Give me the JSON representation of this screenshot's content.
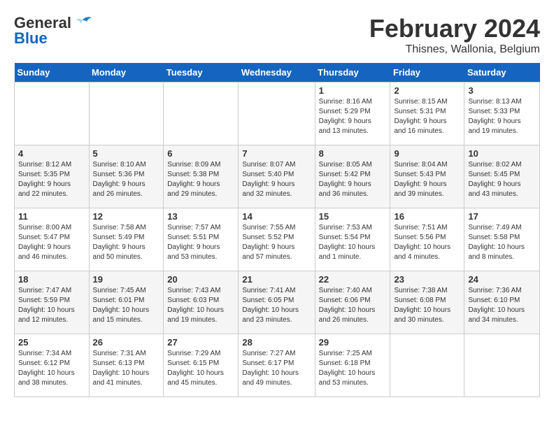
{
  "header": {
    "logo_general": "General",
    "logo_blue": "Blue",
    "month_year": "February 2024",
    "location": "Thisnes, Wallonia, Belgium"
  },
  "days_of_week": [
    "Sunday",
    "Monday",
    "Tuesday",
    "Wednesday",
    "Thursday",
    "Friday",
    "Saturday"
  ],
  "weeks": [
    [
      {
        "day": "",
        "info": ""
      },
      {
        "day": "",
        "info": ""
      },
      {
        "day": "",
        "info": ""
      },
      {
        "day": "",
        "info": ""
      },
      {
        "day": "1",
        "info": "Sunrise: 8:16 AM\nSunset: 5:29 PM\nDaylight: 9 hours\nand 13 minutes."
      },
      {
        "day": "2",
        "info": "Sunrise: 8:15 AM\nSunset: 5:31 PM\nDaylight: 9 hours\nand 16 minutes."
      },
      {
        "day": "3",
        "info": "Sunrise: 8:13 AM\nSunset: 5:33 PM\nDaylight: 9 hours\nand 19 minutes."
      }
    ],
    [
      {
        "day": "4",
        "info": "Sunrise: 8:12 AM\nSunset: 5:35 PM\nDaylight: 9 hours\nand 22 minutes."
      },
      {
        "day": "5",
        "info": "Sunrise: 8:10 AM\nSunset: 5:36 PM\nDaylight: 9 hours\nand 26 minutes."
      },
      {
        "day": "6",
        "info": "Sunrise: 8:09 AM\nSunset: 5:38 PM\nDaylight: 9 hours\nand 29 minutes."
      },
      {
        "day": "7",
        "info": "Sunrise: 8:07 AM\nSunset: 5:40 PM\nDaylight: 9 hours\nand 32 minutes."
      },
      {
        "day": "8",
        "info": "Sunrise: 8:05 AM\nSunset: 5:42 PM\nDaylight: 9 hours\nand 36 minutes."
      },
      {
        "day": "9",
        "info": "Sunrise: 8:04 AM\nSunset: 5:43 PM\nDaylight: 9 hours\nand 39 minutes."
      },
      {
        "day": "10",
        "info": "Sunrise: 8:02 AM\nSunset: 5:45 PM\nDaylight: 9 hours\nand 43 minutes."
      }
    ],
    [
      {
        "day": "11",
        "info": "Sunrise: 8:00 AM\nSunset: 5:47 PM\nDaylight: 9 hours\nand 46 minutes."
      },
      {
        "day": "12",
        "info": "Sunrise: 7:58 AM\nSunset: 5:49 PM\nDaylight: 9 hours\nand 50 minutes."
      },
      {
        "day": "13",
        "info": "Sunrise: 7:57 AM\nSunset: 5:51 PM\nDaylight: 9 hours\nand 53 minutes."
      },
      {
        "day": "14",
        "info": "Sunrise: 7:55 AM\nSunset: 5:52 PM\nDaylight: 9 hours\nand 57 minutes."
      },
      {
        "day": "15",
        "info": "Sunrise: 7:53 AM\nSunset: 5:54 PM\nDaylight: 10 hours\nand 1 minute."
      },
      {
        "day": "16",
        "info": "Sunrise: 7:51 AM\nSunset: 5:56 PM\nDaylight: 10 hours\nand 4 minutes."
      },
      {
        "day": "17",
        "info": "Sunrise: 7:49 AM\nSunset: 5:58 PM\nDaylight: 10 hours\nand 8 minutes."
      }
    ],
    [
      {
        "day": "18",
        "info": "Sunrise: 7:47 AM\nSunset: 5:59 PM\nDaylight: 10 hours\nand 12 minutes."
      },
      {
        "day": "19",
        "info": "Sunrise: 7:45 AM\nSunset: 6:01 PM\nDaylight: 10 hours\nand 15 minutes."
      },
      {
        "day": "20",
        "info": "Sunrise: 7:43 AM\nSunset: 6:03 PM\nDaylight: 10 hours\nand 19 minutes."
      },
      {
        "day": "21",
        "info": "Sunrise: 7:41 AM\nSunset: 6:05 PM\nDaylight: 10 hours\nand 23 minutes."
      },
      {
        "day": "22",
        "info": "Sunrise: 7:40 AM\nSunset: 6:06 PM\nDaylight: 10 hours\nand 26 minutes."
      },
      {
        "day": "23",
        "info": "Sunrise: 7:38 AM\nSunset: 6:08 PM\nDaylight: 10 hours\nand 30 minutes."
      },
      {
        "day": "24",
        "info": "Sunrise: 7:36 AM\nSunset: 6:10 PM\nDaylight: 10 hours\nand 34 minutes."
      }
    ],
    [
      {
        "day": "25",
        "info": "Sunrise: 7:34 AM\nSunset: 6:12 PM\nDaylight: 10 hours\nand 38 minutes."
      },
      {
        "day": "26",
        "info": "Sunrise: 7:31 AM\nSunset: 6:13 PM\nDaylight: 10 hours\nand 41 minutes."
      },
      {
        "day": "27",
        "info": "Sunrise: 7:29 AM\nSunset: 6:15 PM\nDaylight: 10 hours\nand 45 minutes."
      },
      {
        "day": "28",
        "info": "Sunrise: 7:27 AM\nSunset: 6:17 PM\nDaylight: 10 hours\nand 49 minutes."
      },
      {
        "day": "29",
        "info": "Sunrise: 7:25 AM\nSunset: 6:18 PM\nDaylight: 10 hours\nand 53 minutes."
      },
      {
        "day": "",
        "info": ""
      },
      {
        "day": "",
        "info": ""
      }
    ]
  ]
}
